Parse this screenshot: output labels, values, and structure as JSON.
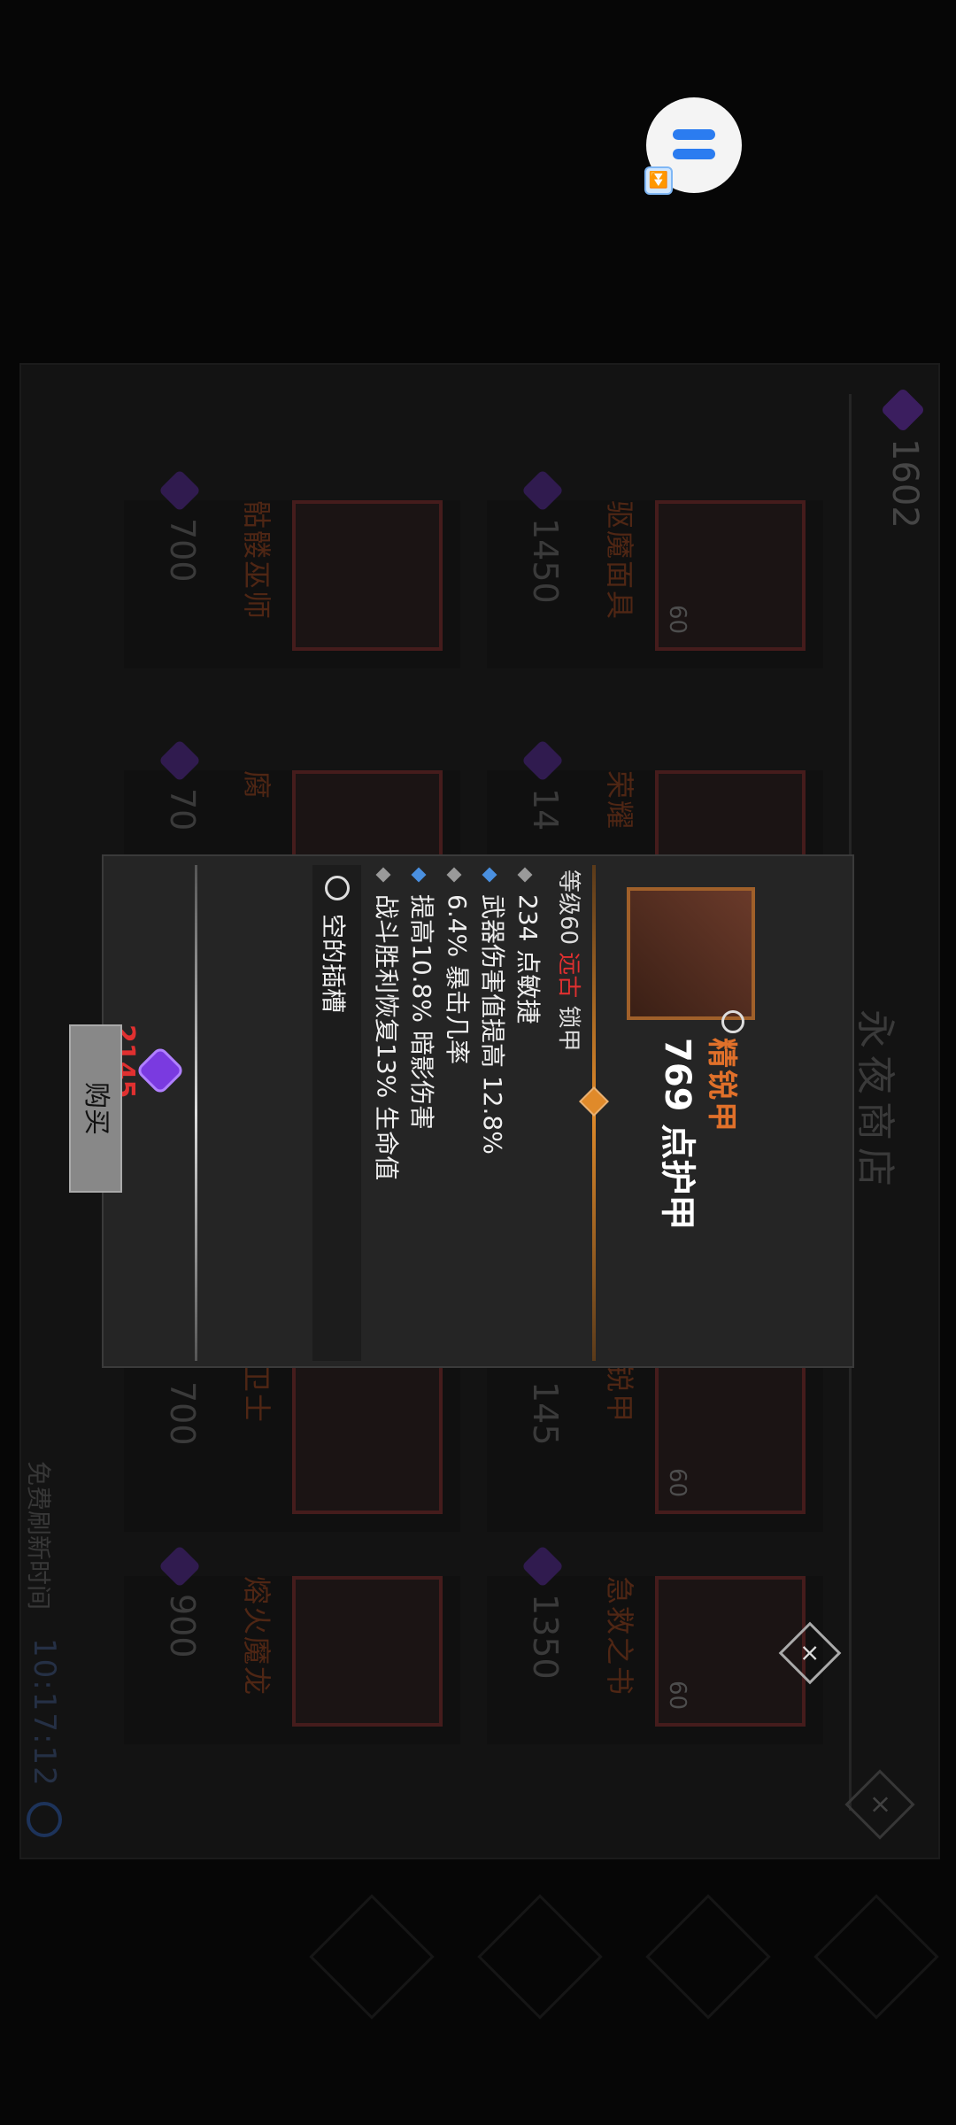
{
  "floating_assistant": {
    "icon": "menu-bars-icon",
    "mini_icon": "double-chevron-down-icon"
  },
  "shop": {
    "title": "永夜商店",
    "currency_amount": "1602",
    "currency_icon": "purple-gem-icon",
    "refresh_label": "免费刷新时间",
    "refresh_timer": "10:17:12",
    "items": [
      {
        "name": "骷髅巫师",
        "price": "700",
        "level": ""
      },
      {
        "name": "驱魔面具",
        "price": "1450",
        "level": "60"
      },
      {
        "name": "腐",
        "price": "70",
        "level": ""
      },
      {
        "name": "荣耀",
        "price": "14",
        "level": ""
      },
      {
        "name": "卫士",
        "price": "700",
        "level": ""
      },
      {
        "name": "锐甲",
        "price": "145",
        "level": "60"
      },
      {
        "name": "熔火魔龙",
        "price": "900",
        "level": ""
      },
      {
        "name": "急救之书",
        "price": "1350",
        "level": "60"
      }
    ]
  },
  "popup": {
    "item_name": "精锐甲",
    "armor": "769 点护甲",
    "requirement_prefix": "等级60",
    "requirement_class": "远古",
    "requirement_suffix": "锁甲",
    "stats": [
      {
        "text": "234 点敏捷",
        "bullet_color": "#9a9a9a"
      },
      {
        "text": "武器伤害值提高 12.8%",
        "bullet_color": "#4a90e0"
      },
      {
        "text": "6.4% 暴击几率",
        "bullet_color": "#9a9a9a"
      },
      {
        "text": "提高10.8% 暗影伤害",
        "bullet_color": "#4a90e0"
      },
      {
        "text": "战斗胜利恢复13% 生命值",
        "bullet_color": "#9a9a9a"
      }
    ],
    "socket_text": "空的插槽",
    "price": "2145",
    "buy_label": "购买"
  },
  "colors": {
    "accent_orange": "#e08a2a",
    "price_red": "#e03030",
    "gem_purple": "#7a3ae0"
  }
}
